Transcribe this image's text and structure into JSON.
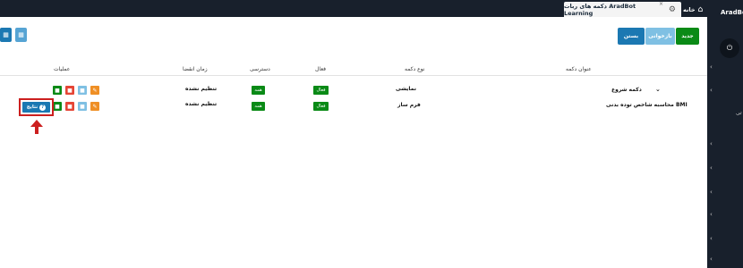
{
  "app": {
    "brand": "AradBot",
    "tabs": [
      {
        "label": "دکمه های ربات AradBot Learning",
        "icon": "bot-icon"
      },
      {
        "label": "خانه",
        "icon": "home-icon"
      }
    ],
    "close_glyph": "×"
  },
  "toolbar": {
    "new_label": "جدید",
    "reload_label": "بازخوانی",
    "close_label": "بستن"
  },
  "table": {
    "columns": {
      "title": "عنوان دکمه",
      "type": "نوع دکمه",
      "active": "فعال",
      "access": "دسترسی",
      "expiry": "زمان انقضا",
      "operations": "عملیات"
    },
    "rows": [
      {
        "title": "دکمه شروع",
        "type": "نمایشی",
        "active": "فعال",
        "access": "همه",
        "expiry": "تنظیم نشده"
      },
      {
        "title": "محاسبه شاخص توده بدنی BMI",
        "type": "فرم ساز",
        "active": "فعال",
        "access": "همه",
        "expiry": "تنظیم نشده"
      }
    ],
    "results_label": "نتایج",
    "results_icon_glyph": "?"
  },
  "sidebar": {
    "partial_label": "تی"
  },
  "colors": {
    "dark": "#18202c",
    "green": "#0a8a16",
    "blue": "#1b78b2",
    "light_blue": "#7fc0e3",
    "orange": "#ef8f25",
    "red": "#e54535",
    "highlight": "#cc1f1f"
  }
}
